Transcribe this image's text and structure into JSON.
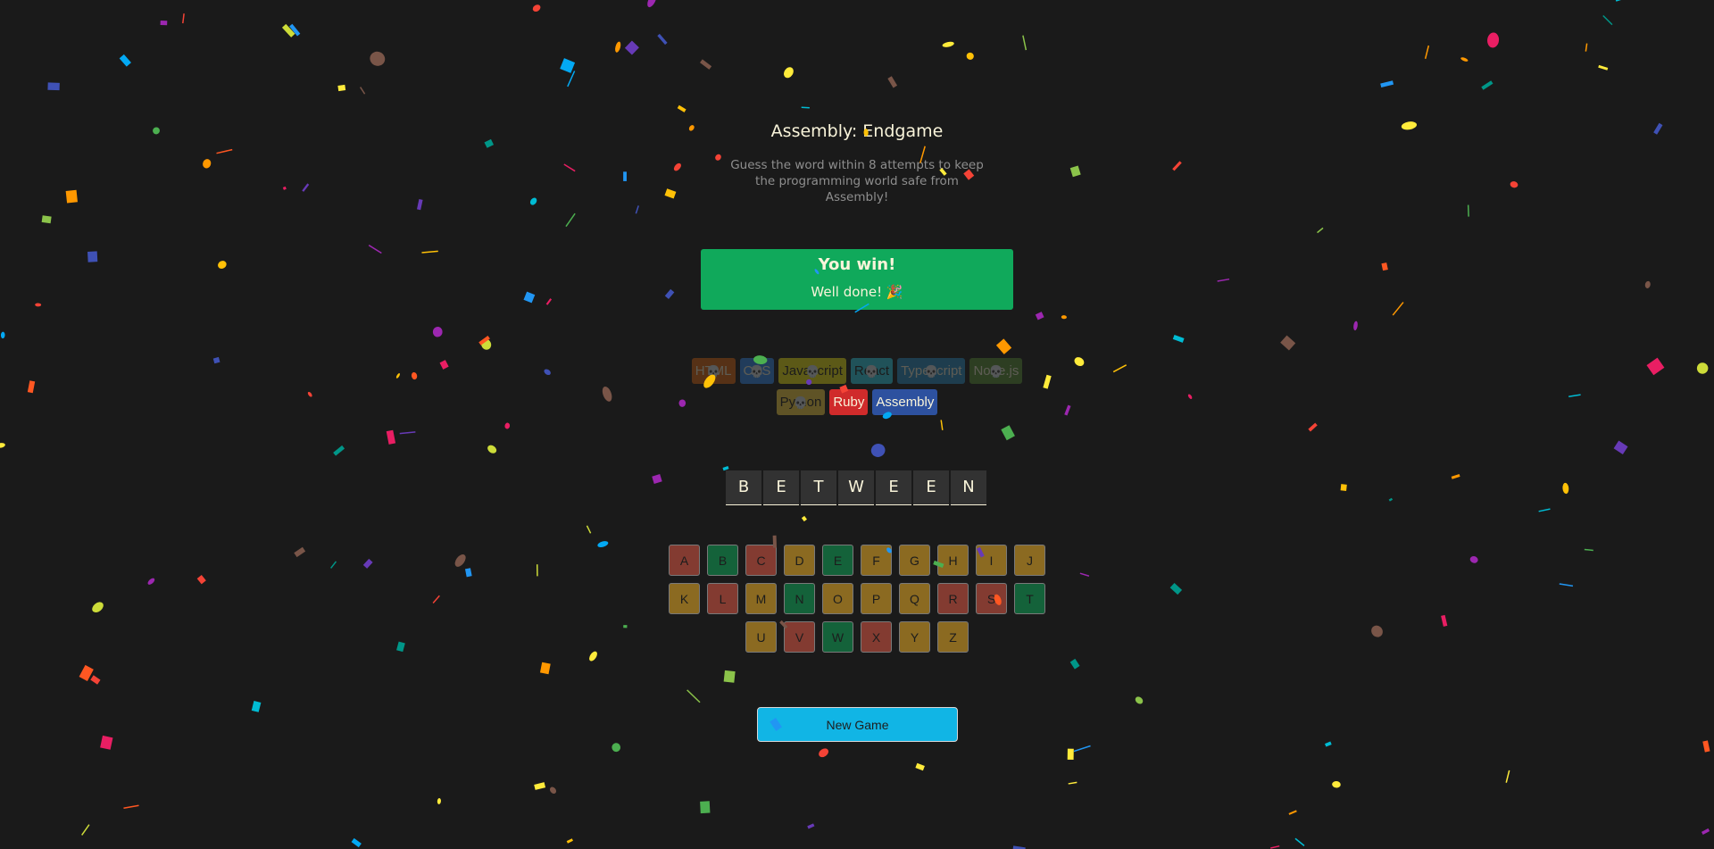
{
  "header": {
    "title": "Assembly: Endgame",
    "subtitle": "Guess the word within 8 attempts to keep the programming world safe from Assembly!"
  },
  "status": {
    "heading": "You win!",
    "message": "Well done! 🎉",
    "color": "#10a95b"
  },
  "languages": [
    {
      "name": "HTML",
      "bg": "#E2680F",
      "fg": "#F9F4DA",
      "lost": true
    },
    {
      "name": "CSS",
      "bg": "#328AF1",
      "fg": "#F9F4DA",
      "lost": true
    },
    {
      "name": "Javascript",
      "bg": "#F4EB13",
      "fg": "#1E1E1E",
      "lost": true
    },
    {
      "name": "React",
      "bg": "#2ED3E9",
      "fg": "#1E1E1E",
      "lost": true
    },
    {
      "name": "Typescript",
      "bg": "#298EC6",
      "fg": "#F9F4DA",
      "lost": true
    },
    {
      "name": "Node.js",
      "bg": "#599137",
      "fg": "#F9F4DA",
      "lost": true
    },
    {
      "name": "Python",
      "bg": "#FFD742",
      "fg": "#1E1E1E",
      "lost": true
    },
    {
      "name": "Ruby",
      "bg": "#D02B2B",
      "fg": "#F9F4DA",
      "lost": false
    },
    {
      "name": "Assembly",
      "bg": "#2D519F",
      "fg": "#F9F4DA",
      "lost": false
    }
  ],
  "skull_icon": "💀",
  "word": [
    "B",
    "E",
    "T",
    "W",
    "E",
    "E",
    "N"
  ],
  "keyboard": [
    {
      "letter": "A",
      "state": "red"
    },
    {
      "letter": "B",
      "state": "green"
    },
    {
      "letter": "C",
      "state": "red"
    },
    {
      "letter": "D",
      "state": "yellow"
    },
    {
      "letter": "E",
      "state": "green"
    },
    {
      "letter": "F",
      "state": "yellow"
    },
    {
      "letter": "G",
      "state": "yellow"
    },
    {
      "letter": "H",
      "state": "yellow"
    },
    {
      "letter": "I",
      "state": "yellow"
    },
    {
      "letter": "J",
      "state": "yellow"
    },
    {
      "letter": "K",
      "state": "yellow"
    },
    {
      "letter": "L",
      "state": "red"
    },
    {
      "letter": "M",
      "state": "yellow"
    },
    {
      "letter": "N",
      "state": "green"
    },
    {
      "letter": "O",
      "state": "yellow"
    },
    {
      "letter": "P",
      "state": "yellow"
    },
    {
      "letter": "Q",
      "state": "yellow"
    },
    {
      "letter": "R",
      "state": "red"
    },
    {
      "letter": "S",
      "state": "red"
    },
    {
      "letter": "T",
      "state": "green"
    },
    {
      "letter": "U",
      "state": "yellow"
    },
    {
      "letter": "V",
      "state": "red"
    },
    {
      "letter": "W",
      "state": "green"
    },
    {
      "letter": "X",
      "state": "red"
    },
    {
      "letter": "Y",
      "state": "yellow"
    },
    {
      "letter": "Z",
      "state": "yellow"
    }
  ],
  "new_game_label": "New Game",
  "colors": {
    "background": "#1a1a1a",
    "key_yellow": "#fcba29",
    "key_green": "#10a95b",
    "key_red": "#ec5d49",
    "button": "#11b5e5"
  }
}
